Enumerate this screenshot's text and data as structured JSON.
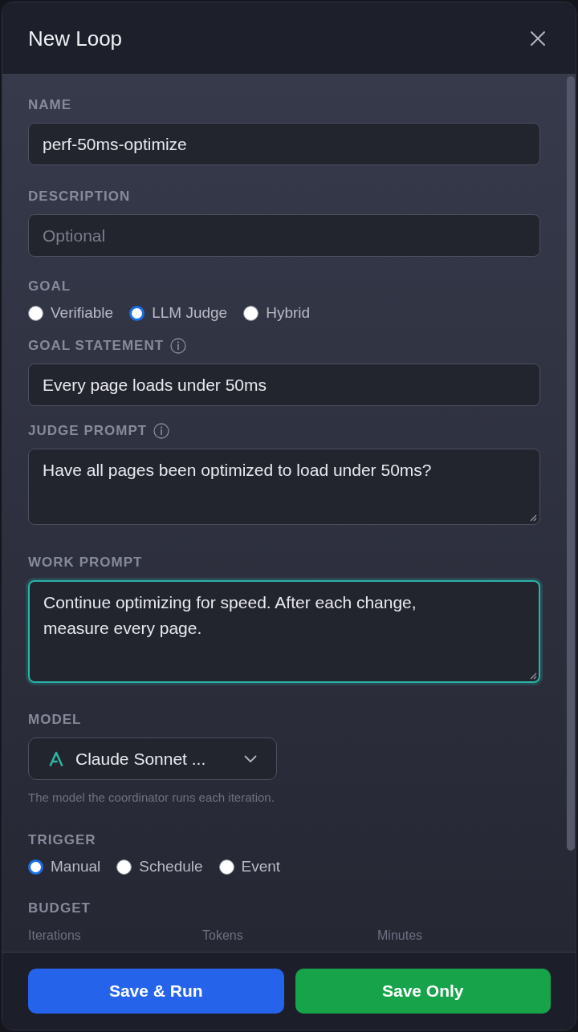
{
  "dialog": {
    "title": "New Loop"
  },
  "form": [
    {
      "kind": "input",
      "label": "NAME",
      "value": "perf-50ms-optimize"
    },
    {
      "kind": "input",
      "label": "DESCRIPTION",
      "placeholder": "Optional"
    },
    {
      "kind": "radio",
      "label": "GOAL",
      "options": [
        {
          "label": "Verifiable",
          "selected": false
        },
        {
          "label": "LLM Judge",
          "selected": true
        },
        {
          "label": "Hybrid",
          "selected": false
        }
      ]
    },
    {
      "kind": "input",
      "label": "GOAL STATEMENT",
      "info": true,
      "value": "Every page loads under 50ms"
    },
    {
      "kind": "textarea",
      "label": "JUDGE PROMPT",
      "info": true,
      "value": "Have all pages been optimized to load under 50ms?",
      "focused": false
    },
    {
      "kind": "textarea",
      "label": "WORK PROMPT",
      "value": "Continue optimizing for speed. After each change, measure every page.",
      "focused": true
    },
    {
      "kind": "select",
      "label": "MODEL",
      "value": "Claude Sonnet ...",
      "hint": "The model the coordinator runs each iteration."
    },
    {
      "kind": "radio",
      "label": "TRIGGER",
      "options": [
        {
          "label": "Manual",
          "selected": true
        },
        {
          "label": "Schedule",
          "selected": false
        },
        {
          "label": "Event",
          "selected": false
        }
      ]
    },
    {
      "kind": "budget",
      "label": "BUDGET",
      "columns": [
        "Iterations",
        "Tokens",
        "Minutes"
      ]
    }
  ],
  "footer": {
    "buttons": [
      {
        "label": "Save & Run",
        "kind": "primary"
      },
      {
        "label": "Save Only",
        "kind": "success"
      }
    ]
  }
}
